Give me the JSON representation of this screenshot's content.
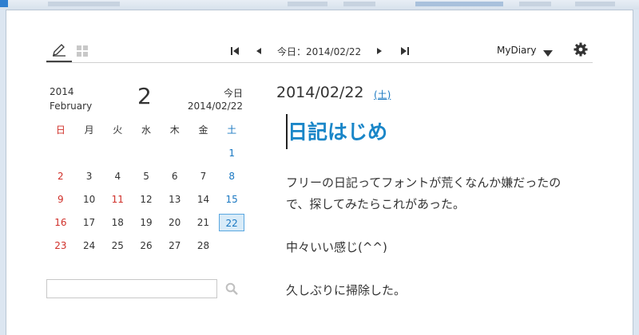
{
  "toolbar": {
    "today_label": "今日：2014/02/22",
    "diary_name": "MyDiary"
  },
  "calendar": {
    "year": "2014",
    "month_name": "February",
    "month_number": "2",
    "today_label": "今日",
    "today_date": "2014/02/22",
    "weekdays": [
      "日",
      "月",
      "火",
      "水",
      "木",
      "金",
      "土"
    ],
    "rows": [
      [
        "",
        "",
        "",
        "",
        "",
        "",
        "1"
      ],
      [
        "2",
        "3",
        "4",
        "5",
        "6",
        "7",
        "8"
      ],
      [
        "9",
        "10",
        "11",
        "12",
        "13",
        "14",
        "15"
      ],
      [
        "16",
        "17",
        "18",
        "19",
        "20",
        "21",
        "22"
      ],
      [
        "23",
        "24",
        "25",
        "26",
        "27",
        "28",
        ""
      ]
    ],
    "selected_day": "22",
    "holiday_days": [
      "11"
    ]
  },
  "search": {
    "value": "",
    "placeholder": ""
  },
  "entry": {
    "date": "2014/02/22",
    "day_of_week": "(土)",
    "title": "日記はじめ",
    "paragraphs": [
      "フリーの日記ってフォントが荒くなんか嫌だったので、探してみたらこれがあった。",
      "中々いい感じ(^^)",
      "久しぶりに掃除した。"
    ]
  },
  "colors": {
    "accent": "#1a86c8",
    "sunday": "#d0302a",
    "saturday": "#1a78c2",
    "selected_bg": "#d8ebf8"
  }
}
